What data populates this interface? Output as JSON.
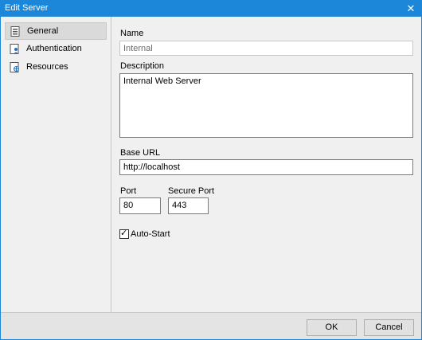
{
  "window": {
    "title": "Edit Server"
  },
  "sidebar": {
    "items": [
      {
        "label": "General",
        "icon": "general-page-icon",
        "selected": true
      },
      {
        "label": "Authentication",
        "icon": "user-page-icon",
        "selected": false
      },
      {
        "label": "Resources",
        "icon": "resources-page-icon",
        "selected": false
      }
    ]
  },
  "form": {
    "name_label": "Name",
    "name_value": "Internal",
    "description_label": "Description",
    "description_value": "Internal Web Server",
    "base_url_label": "Base URL",
    "base_url_value": "http://localhost",
    "port_label": "Port",
    "port_value": "80",
    "secure_port_label": "Secure Port",
    "secure_port_value": "443",
    "auto_start_label": "Auto-Start",
    "auto_start_checked": true
  },
  "footer": {
    "ok_label": "OK",
    "cancel_label": "Cancel"
  },
  "colors": {
    "titlebar": "#1c87d8",
    "panel": "#f0f0f0"
  }
}
